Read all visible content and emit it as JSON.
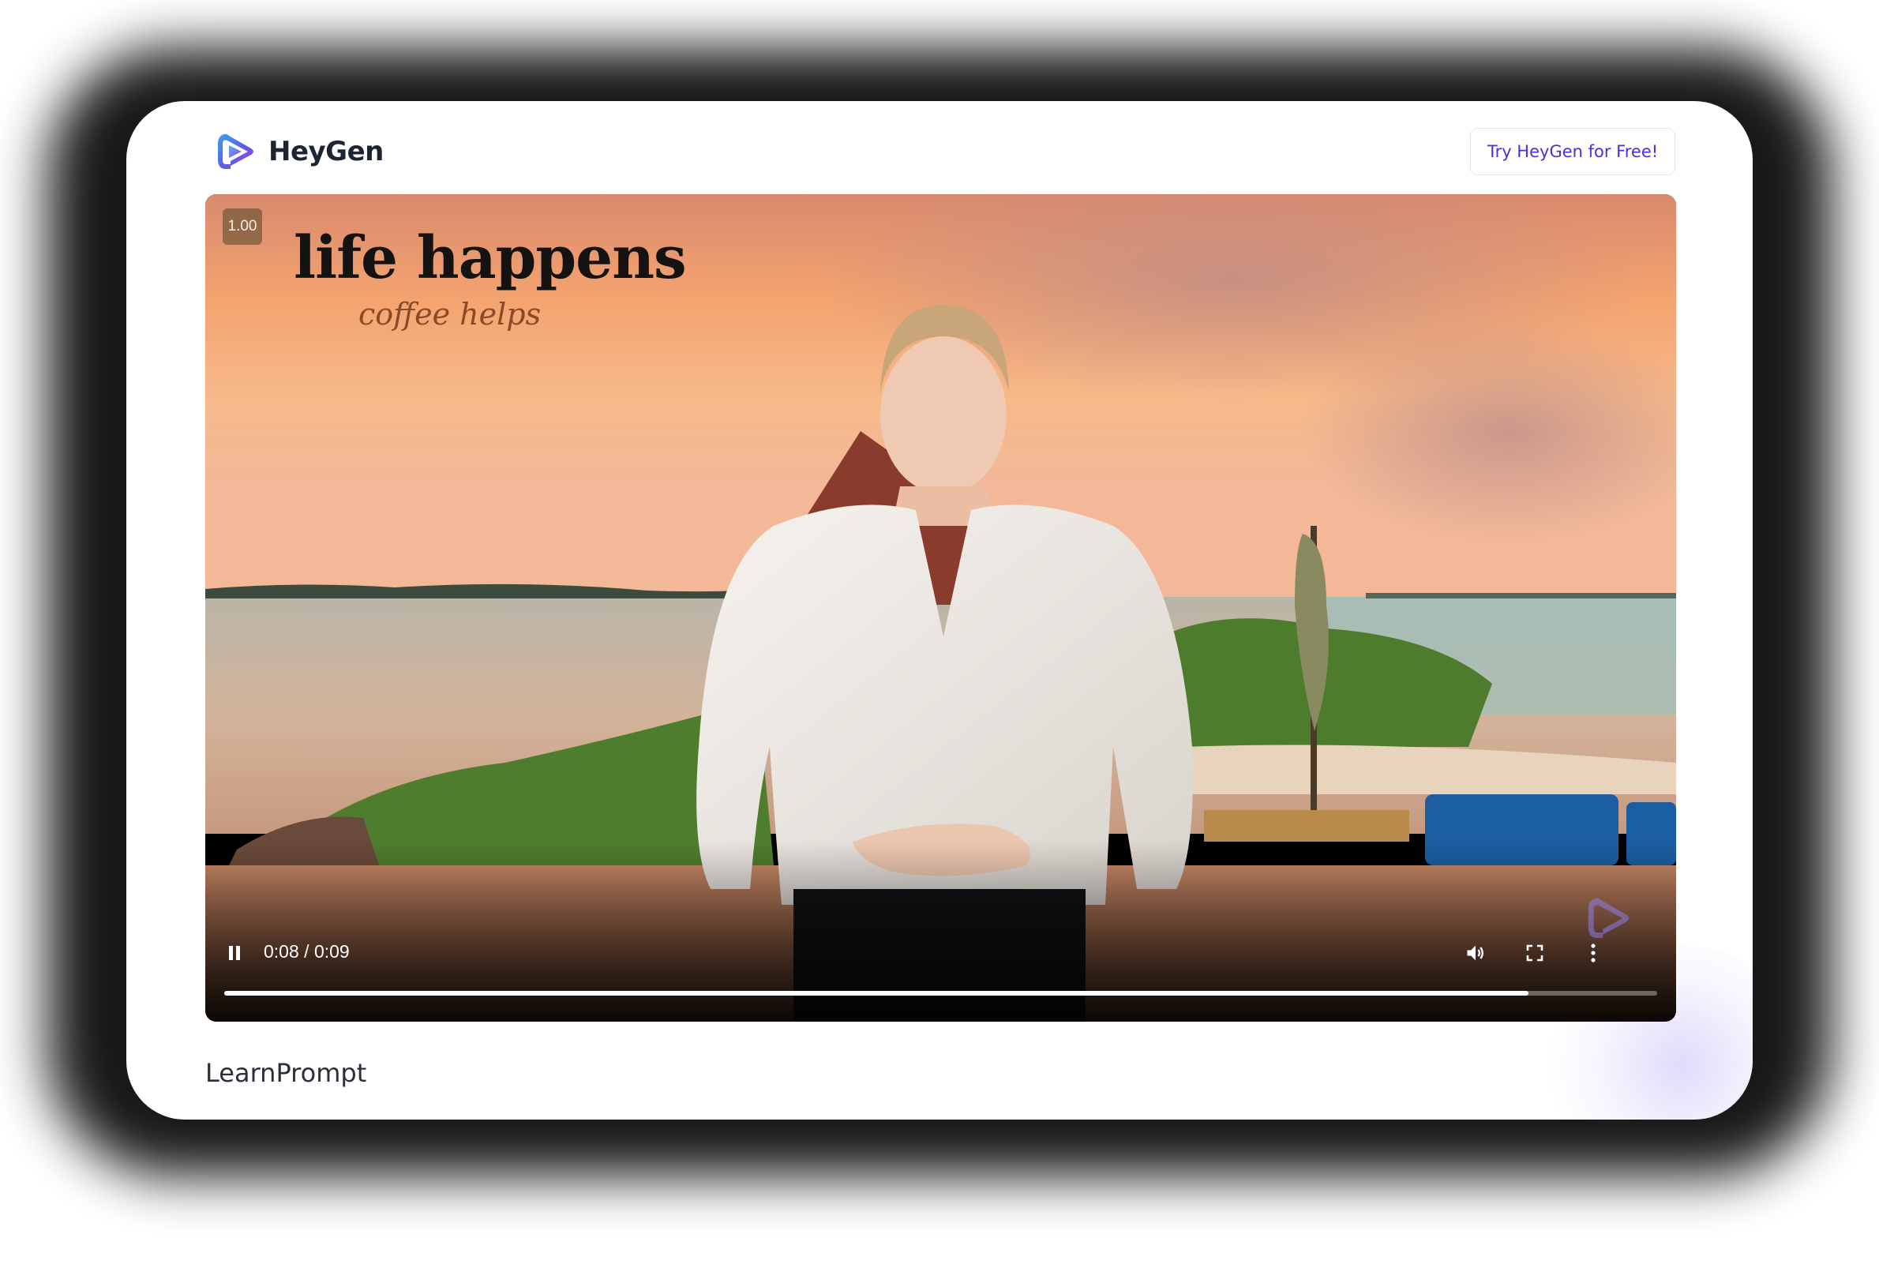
{
  "brand": {
    "name": "HeyGen",
    "cta_label": "Try HeyGen for Free!",
    "accent_color": "#4b30d8"
  },
  "player": {
    "speed_badge": "1.00",
    "overlay_title": "life happens",
    "overlay_subtitle": "coffee helps",
    "current_time": "0:08",
    "time_separator": " / ",
    "duration": "0:09",
    "progress": 0.91,
    "state": "playing",
    "icons": {
      "play_pause": "pause-icon",
      "volume": "volume-icon",
      "fullscreen": "fullscreen-icon",
      "more": "more-vertical-icon"
    }
  },
  "footer": {
    "label": "LearnPrompt"
  }
}
